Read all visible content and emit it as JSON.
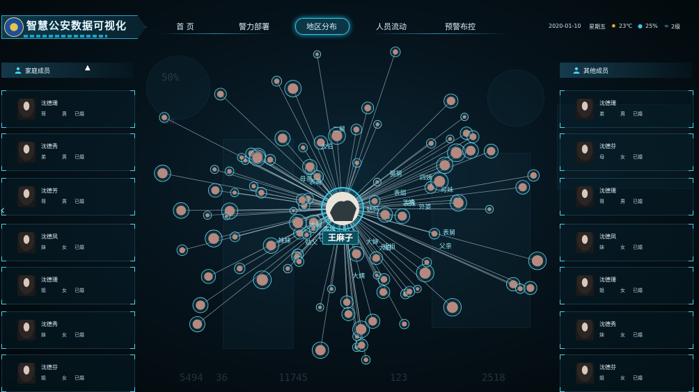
{
  "header": {
    "app_title": "智慧公安数据可视化",
    "nav": [
      {
        "label": "首 页"
      },
      {
        "label": "警力部署"
      },
      {
        "label": "地区分布"
      },
      {
        "label": "人员流动"
      },
      {
        "label": "预警布控"
      }
    ],
    "active_nav": "地区分布",
    "date": "2020-01-10",
    "weekday": "星期五",
    "temperature": "23℃",
    "humidity": "25%",
    "wind": "2级"
  },
  "left_panel": {
    "title": "家庭成员",
    "members": [
      {
        "name": "沈德珊",
        "relation": "哥",
        "gender": "男",
        "status": "已婚"
      },
      {
        "name": "沈德秀",
        "relation": "弟",
        "gender": "男",
        "status": "已婚"
      },
      {
        "name": "沈德芳",
        "relation": "哥",
        "gender": "男",
        "status": "已婚"
      },
      {
        "name": "沈德凤",
        "relation": "妹",
        "gender": "女",
        "status": "已婚"
      },
      {
        "name": "沈德珊",
        "relation": "姐",
        "gender": "女",
        "status": "已婚"
      },
      {
        "name": "沈德秀",
        "relation": "妹",
        "gender": "女",
        "status": "已婚"
      },
      {
        "name": "沈德芬",
        "relation": "姐",
        "gender": "女",
        "status": "已婚"
      }
    ]
  },
  "right_panel": {
    "title": "其他成员",
    "members": [
      {
        "name": "沈德珊",
        "relation": "弟",
        "gender": "男",
        "status": "已婚"
      },
      {
        "name": "沈德芬",
        "relation": "母",
        "gender": "女",
        "status": "已婚"
      },
      {
        "name": "沈德珊",
        "relation": "哥",
        "gender": "男",
        "status": "已婚"
      },
      {
        "name": "沈德凤",
        "relation": "妹",
        "gender": "女",
        "status": "已婚"
      },
      {
        "name": "沈德珊",
        "relation": "姐",
        "gender": "女",
        "status": "已婚"
      },
      {
        "name": "沈德秀",
        "relation": "妹",
        "gender": "女",
        "status": "已婚"
      },
      {
        "name": "沈德芬",
        "relation": "姐",
        "gender": "女",
        "status": "已婚"
      }
    ]
  },
  "graph": {
    "center_name": "王麻子",
    "labels": [
      "大舅",
      "表舅",
      "二姨",
      "舅舅",
      "妹妹",
      "大姨",
      "表姨",
      "表妹",
      "大伯",
      "姐姐",
      "外婆",
      "四姨",
      "母亲",
      "可妹",
      "父亲",
      "姑父",
      "婶婶",
      "大婶",
      "姑妈",
      "二舅",
      "表姐",
      "二姨",
      "表哥",
      "叔叔",
      "舅妈",
      "大伯"
    ]
  },
  "background_readouts": {
    "percent": "50%",
    "stats": [
      "5494",
      "36",
      "11745",
      "2518",
      "123"
    ],
    "small_value": "45件"
  },
  "colors": {
    "accent": "#39c6e6",
    "edge": "#d8f3fb",
    "label": "#8fe0ee",
    "node_ring": "#6fd8ec"
  }
}
